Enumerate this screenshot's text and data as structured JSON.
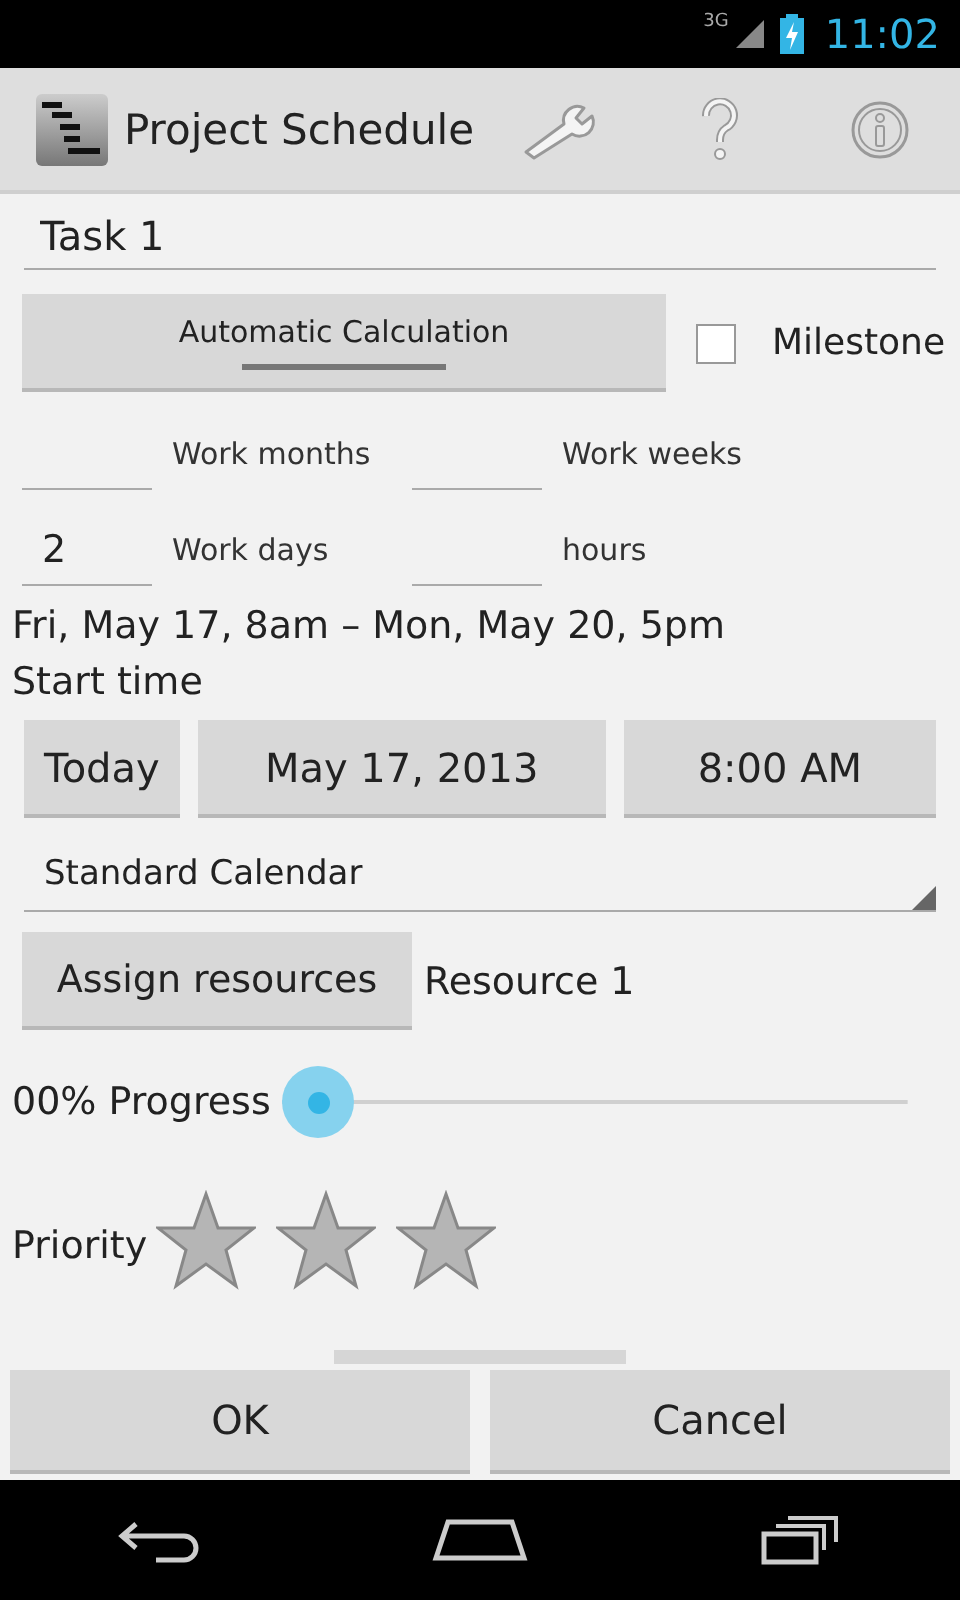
{
  "status_bar": {
    "network": "3G",
    "time": "11:02"
  },
  "action_bar": {
    "title": "Project Schedule"
  },
  "task_name": {
    "value": "Task 1"
  },
  "auto_calc": {
    "label": "Automatic Calculation",
    "on": false
  },
  "milestone": {
    "label": "Milestone",
    "checked": false
  },
  "durations": [
    {
      "label": "Work months"
    },
    {
      "label": "Work weeks"
    },
    {
      "value": "2",
      "label": "Work days"
    },
    {
      "label": "hours"
    }
  ],
  "range": "Fri, May 17, 8am – Mon, May 20, 5pm",
  "start_label": "Start time",
  "start_buttons": [
    "Today",
    "May 17, 2013",
    "8:00 AM"
  ],
  "calendar": {
    "value": "Standard Calendar"
  },
  "assign": {
    "button": "Assign resources",
    "value": "Resource 1"
  },
  "progress": {
    "label": "00% Progress"
  },
  "priority": {
    "label": "Priority",
    "stars": 0
  },
  "buttons": [
    "OK",
    "Cancel"
  ]
}
